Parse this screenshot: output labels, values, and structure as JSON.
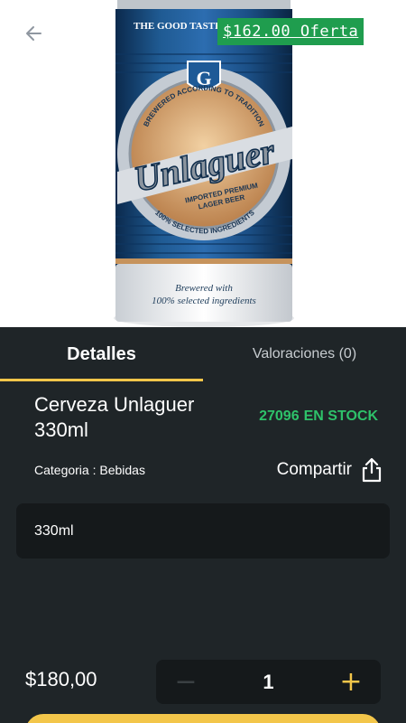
{
  "product": {
    "offer_badge": "$162.00 Oferta",
    "name": "Cerveza Unlaguer 330ml",
    "stock_count": "27096",
    "stock_label": "EN STOCK",
    "category_line": "Categoria : Bebidas",
    "share_label": "Compartir",
    "variant": "330ml",
    "price": "$180,00"
  },
  "can_art": {
    "top_text": "THE GOOD TASTE",
    "arc_text": "BREWERED ACCORDING TO TRADITION",
    "brand": "Unlaguer",
    "sub_1": "IMPORTED PREMIUM",
    "sub_2": "LAGER BEER",
    "ring_text": "100% SELECTED INGREDIENTS",
    "foot_1": "Brewered with",
    "foot_2": "100% selected ingredients"
  },
  "tabs": [
    {
      "label": "Detalles",
      "active": true
    },
    {
      "label": "Valoraciones (0)",
      "active": false
    }
  ],
  "quantity": {
    "value": "1",
    "minus": "−",
    "plus": "+"
  },
  "icons": {
    "back": "arrow-left-icon",
    "share": "share-icon"
  },
  "colors": {
    "background": "#1f2528",
    "accent": "#f3c64a",
    "stock_green": "#2ec26a",
    "offer_green": "#1f9d4e",
    "field": "#15191b"
  }
}
